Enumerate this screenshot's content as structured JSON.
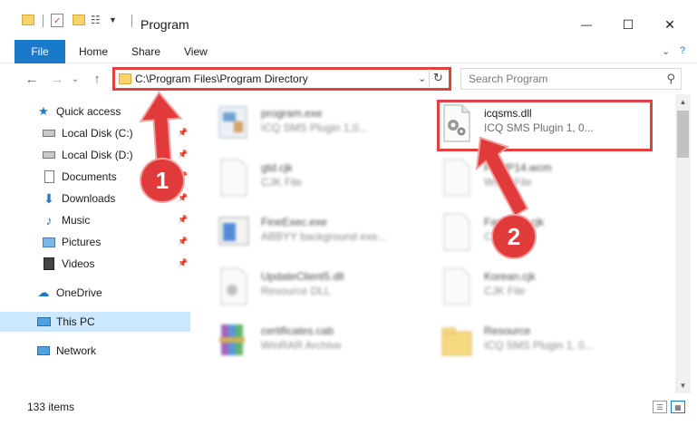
{
  "window": {
    "title": "Program",
    "minimize_glyph": "—",
    "maximize_glyph": "☐",
    "close_glyph": "✕"
  },
  "ribbon": {
    "tabs": [
      "File",
      "Home",
      "Share",
      "View"
    ]
  },
  "address": {
    "path": "C:\\Program Files\\Program Directory",
    "chevron_glyph": "⌄",
    "refresh_glyph": "↻"
  },
  "search": {
    "placeholder": "Search Program"
  },
  "nav": {
    "back_glyph": "←",
    "forward_glyph": "→",
    "recent_glyph": "⌄",
    "up_glyph": "↑",
    "items": [
      {
        "label": "Quick access",
        "icon": "star-icon",
        "pinned": false,
        "selected": false,
        "indent": 1
      },
      {
        "label": "Local Disk (C:)",
        "icon": "drive-icon",
        "pinned": true,
        "selected": false,
        "indent": 2
      },
      {
        "label": "Local Disk (D:)",
        "icon": "drive-icon",
        "pinned": true,
        "selected": false,
        "indent": 2
      },
      {
        "label": "Documents",
        "icon": "documents-icon",
        "pinned": true,
        "selected": false,
        "indent": 2
      },
      {
        "label": "Downloads",
        "icon": "download-icon",
        "pinned": true,
        "selected": false,
        "indent": 2
      },
      {
        "label": "Music",
        "icon": "music-icon",
        "pinned": true,
        "selected": false,
        "indent": 2
      },
      {
        "label": "Pictures",
        "icon": "pictures-icon",
        "pinned": true,
        "selected": false,
        "indent": 2
      },
      {
        "label": "Videos",
        "icon": "videos-icon",
        "pinned": true,
        "selected": false,
        "indent": 2
      },
      {
        "label": "OneDrive",
        "icon": "cloud-icon",
        "pinned": false,
        "selected": false,
        "indent": 1
      },
      {
        "label": "This PC",
        "icon": "computer-icon",
        "pinned": false,
        "selected": true,
        "indent": 1
      },
      {
        "label": "Network",
        "icon": "network-icon",
        "pinned": false,
        "selected": false,
        "indent": 1
      }
    ]
  },
  "files": [
    {
      "name": "program.exe",
      "type": "ICQ SMS Plugin 1,0...",
      "icon": "exe-icon",
      "blurred": true
    },
    {
      "name": "icqsms.dll",
      "type": "ICQ SMS Plugin 1, 0...",
      "icon": "dll-file-icon",
      "blurred": false
    },
    {
      "name": "gtd.cjk",
      "type": "CJK File",
      "icon": "blank-file-icon",
      "blurred": true
    },
    {
      "name": "FoWP14.wcm",
      "type": "WCM File",
      "icon": "blank-file-icon",
      "blurred": true
    },
    {
      "name": "FineExec.exe",
      "type": "ABBYY background exe...",
      "icon": "app-icon",
      "blurred": true
    },
    {
      "name": "FastHunl.cjk",
      "type": "CJK File",
      "icon": "blank-file-icon",
      "blurred": true
    },
    {
      "name": "UpdateClient5.dll",
      "type": "Resource DLL",
      "icon": "gear-file-icon",
      "blurred": true
    },
    {
      "name": "Korean.cjk",
      "type": "CJK File",
      "icon": "blank-file-icon",
      "blurred": true
    },
    {
      "name": "certificates.cab",
      "type": "WinRAR Archive",
      "icon": "archive-icon",
      "blurred": true
    },
    {
      "name": "Resource",
      "type": "ICQ SMS Plugin 1, 0...",
      "icon": "folder-icon",
      "blurred": true
    }
  ],
  "status": {
    "item_count": "133 items"
  },
  "callouts": [
    "1",
    "2"
  ],
  "colors": {
    "accent": "#1979ca",
    "highlight_red": "#e04040",
    "selected_nav": "#cce8ff"
  }
}
